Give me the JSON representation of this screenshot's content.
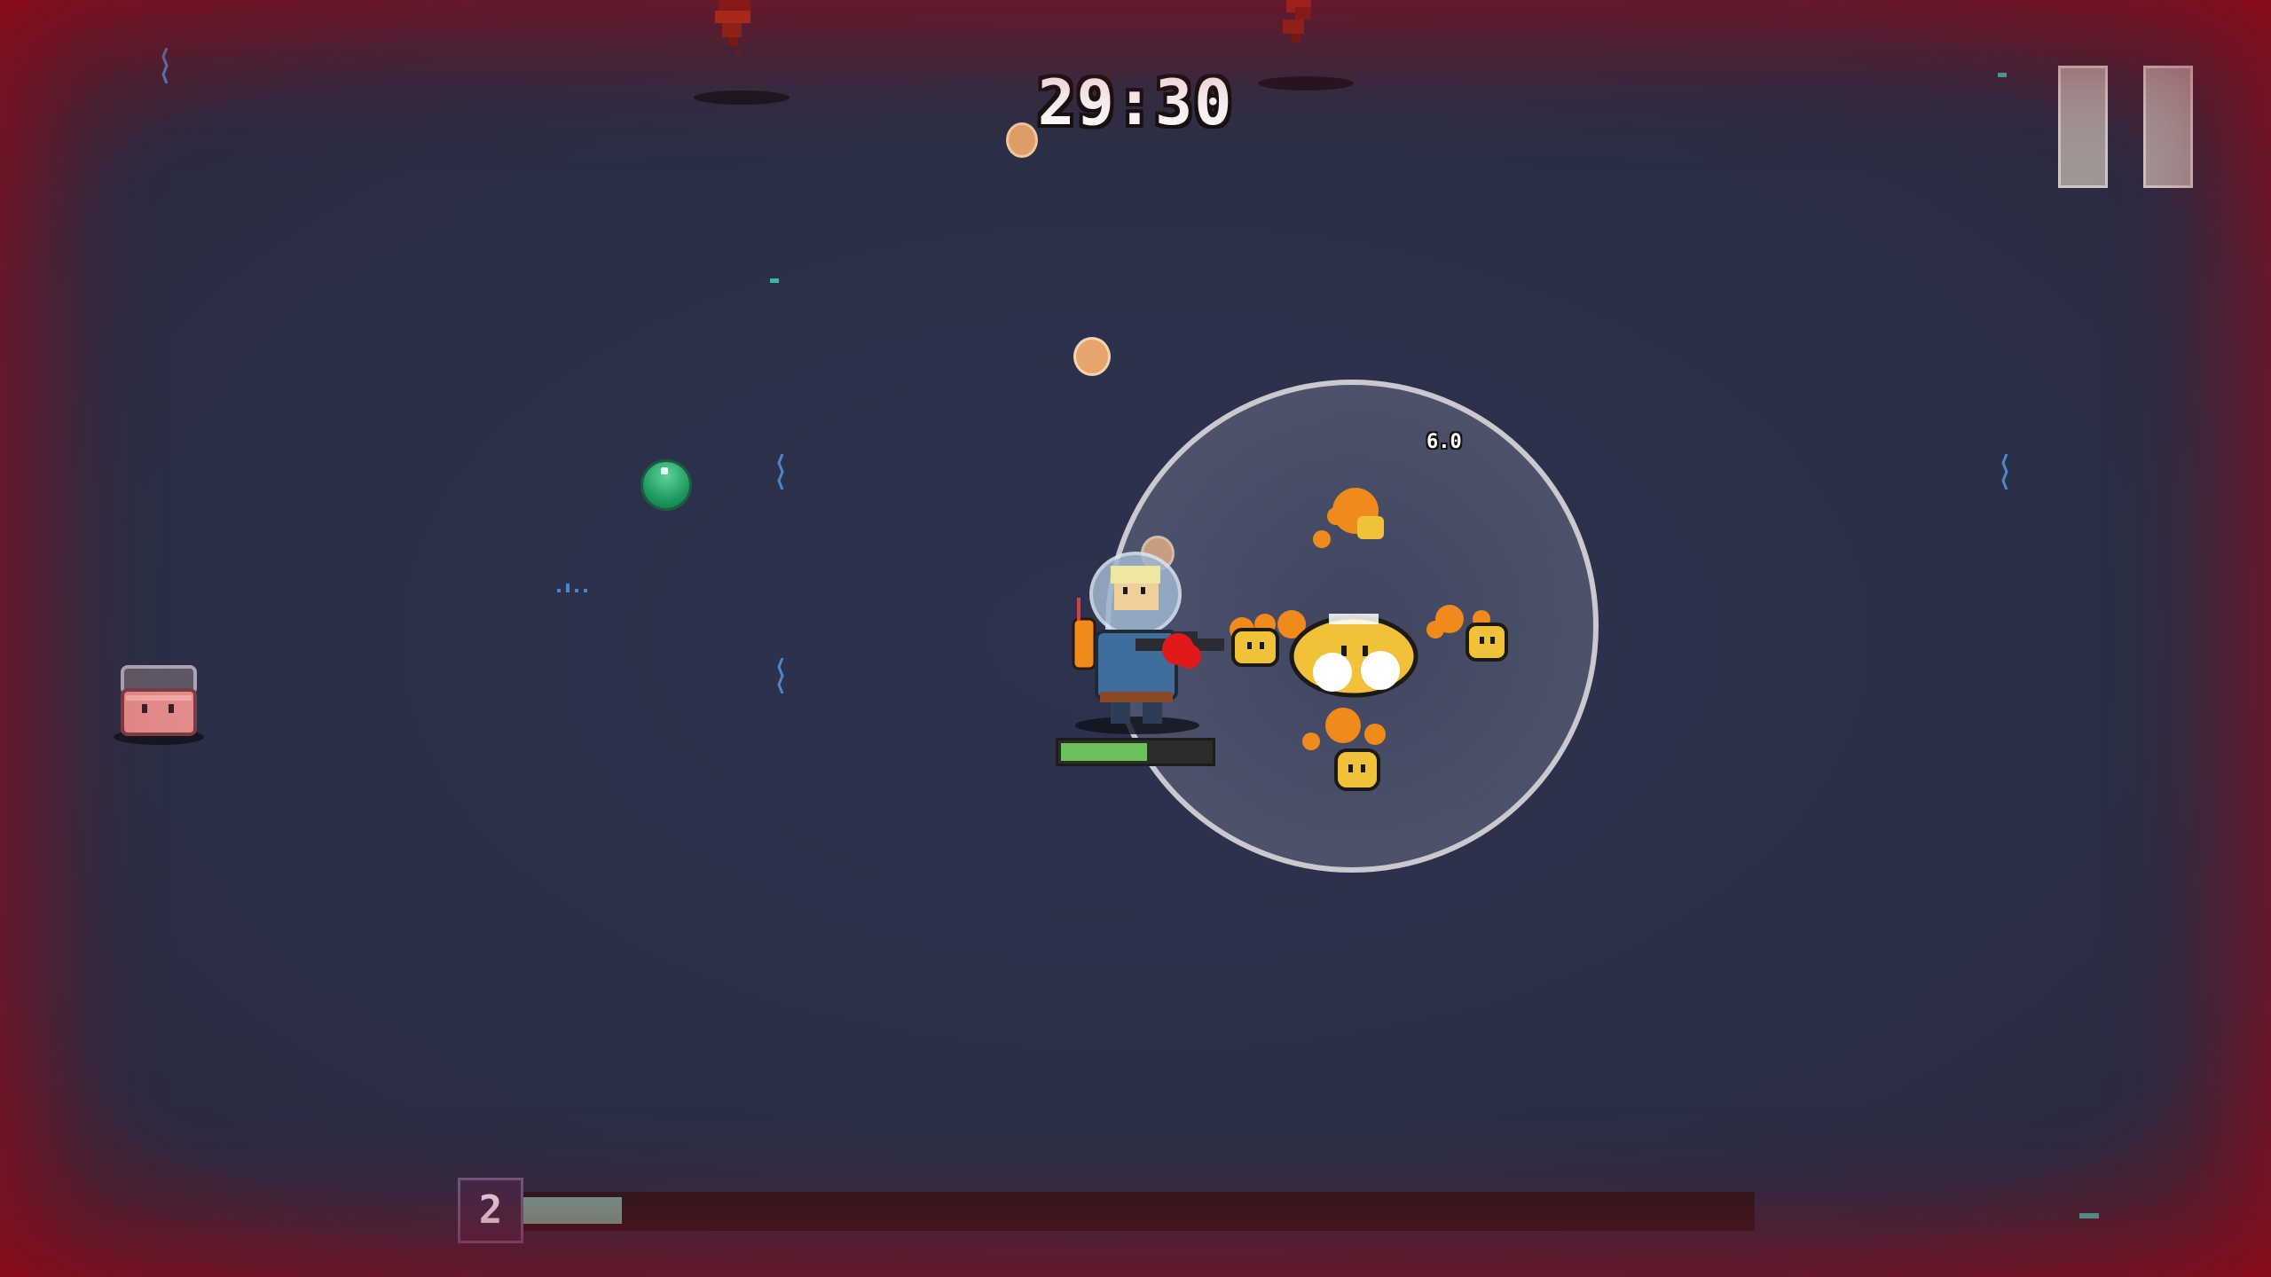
{
  "hud": {
    "timer": "29:30",
    "level": "2",
    "xp_progress": 0.08,
    "player_health": 0.58,
    "damage_number": "6.0"
  },
  "icons": {
    "pause": "pause-icon",
    "green_orb": "xp-orb-icon",
    "player": "player-character-icon",
    "pink_enemy": "enemy-sprite-icon"
  },
  "colors": {
    "background": "#2a3046",
    "vignette": "#8a0f1e",
    "xp_fill": "#6fa497",
    "health_fill": "#6dc05a",
    "timer_text": "#ffffff",
    "fire": "#f08a1c",
    "enemy_yellow": "#f2c13a",
    "enemy_pink": "#e28b8b"
  }
}
